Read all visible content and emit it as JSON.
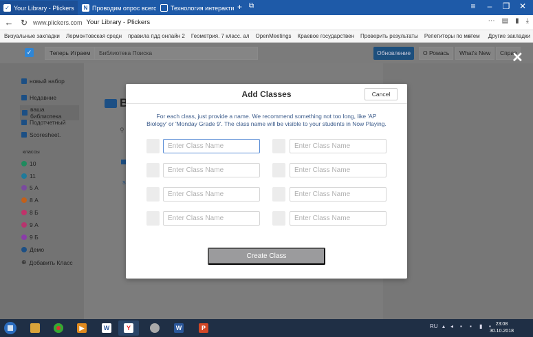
{
  "browser": {
    "tabs": [
      {
        "title": "Your Library - Plickers",
        "close": "×",
        "active": true
      },
      {
        "title": "Проводим опрос всего кла",
        "close": "×",
        "active": false
      },
      {
        "title": "Технология интерактивно",
        "close": "×",
        "active": false
      }
    ],
    "new_tab": "+",
    "url": "www.plickers.com",
    "page_title": "Your Library - Plickers",
    "bookmarks": [
      "Визуальные закладки",
      "Лермонтовская средн",
      "правила пдд онлайн 2",
      "Геометрия. 7 класс. ал",
      "OpenMeetings",
      "Краевое государствен",
      "Проверить результаты",
      "Репетиторы по матем"
    ],
    "bookmarks_more": "»",
    "other_bookmarks": "Другие закладки"
  },
  "app": {
    "now_playing": "Теперь Играем",
    "search_placeholder": "Библиотека Поиска",
    "update_button": "Обновление",
    "user_button": "О Ромась",
    "whats_new": "What's New",
    "help": "Справ"
  },
  "sidebar": {
    "new_set": "новый набор",
    "recent": "Недавние",
    "library": "ваша библиотека",
    "report": "Подотчетный",
    "scoresheet": "Scoresheet.",
    "classes_header": "классы",
    "classes": [
      {
        "name": "10",
        "color": "#1f8a5e"
      },
      {
        "name": "11",
        "color": "#1f7a9a"
      },
      {
        "name": "5 А",
        "color": "#7a4a9e"
      },
      {
        "name": "8 А",
        "color": "#c2601a"
      },
      {
        "name": "8 Б",
        "color": "#c0326a"
      },
      {
        "name": "9 А",
        "color": "#b5356e"
      },
      {
        "name": "9 Б",
        "color": "#8a3ca8"
      },
      {
        "name": "Демо",
        "color": "#1c4f84"
      }
    ],
    "add_class": "Добавить Класс"
  },
  "content": {
    "title_partial": "В",
    "s_mark": "S"
  },
  "modal": {
    "title": "Add Classes",
    "cancel": "Cancel",
    "description": "For each class, just provide a name. We recommend something not too long, like 'AP Biology' or 'Monday Grade 9'. The class name will be visible to your students in Now Playing.",
    "placeholder": "Enter Class Name",
    "create_button": "Create Class"
  },
  "taskbar": {
    "lang": "RU",
    "time": "23:08",
    "date": "30.10.2018"
  },
  "colors": {
    "accent": "#2f86d6",
    "browser_chrome": "#1e5aa8",
    "taskbar": "#1f2f45"
  }
}
